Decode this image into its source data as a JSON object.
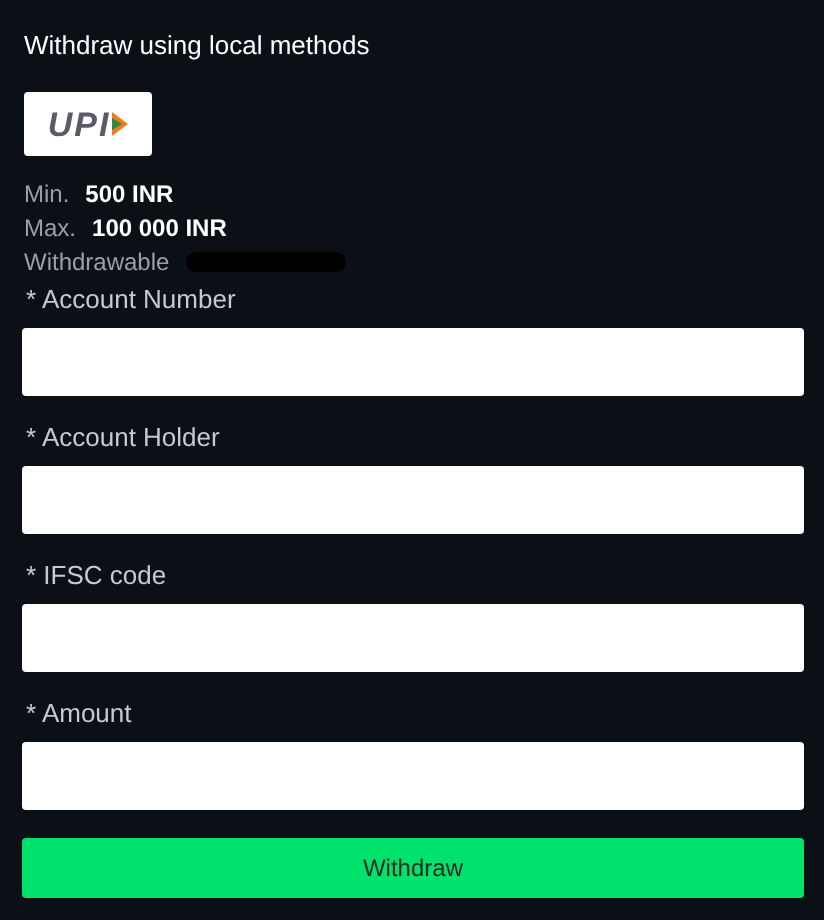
{
  "title": "Withdraw using local methods",
  "method": {
    "logo_text": "UPI"
  },
  "limits": [
    {
      "label": "Min.",
      "value": "500 INR"
    },
    {
      "label": "Max.",
      "value": "100 000 INR"
    }
  ],
  "withdrawable": {
    "label": "Withdrawable",
    "redacted": true
  },
  "fields": [
    {
      "label": "* Account Number"
    },
    {
      "label": "* Account Holder"
    },
    {
      "label": "* IFSC code"
    },
    {
      "label": "* Amount"
    }
  ],
  "button": "Withdraw"
}
